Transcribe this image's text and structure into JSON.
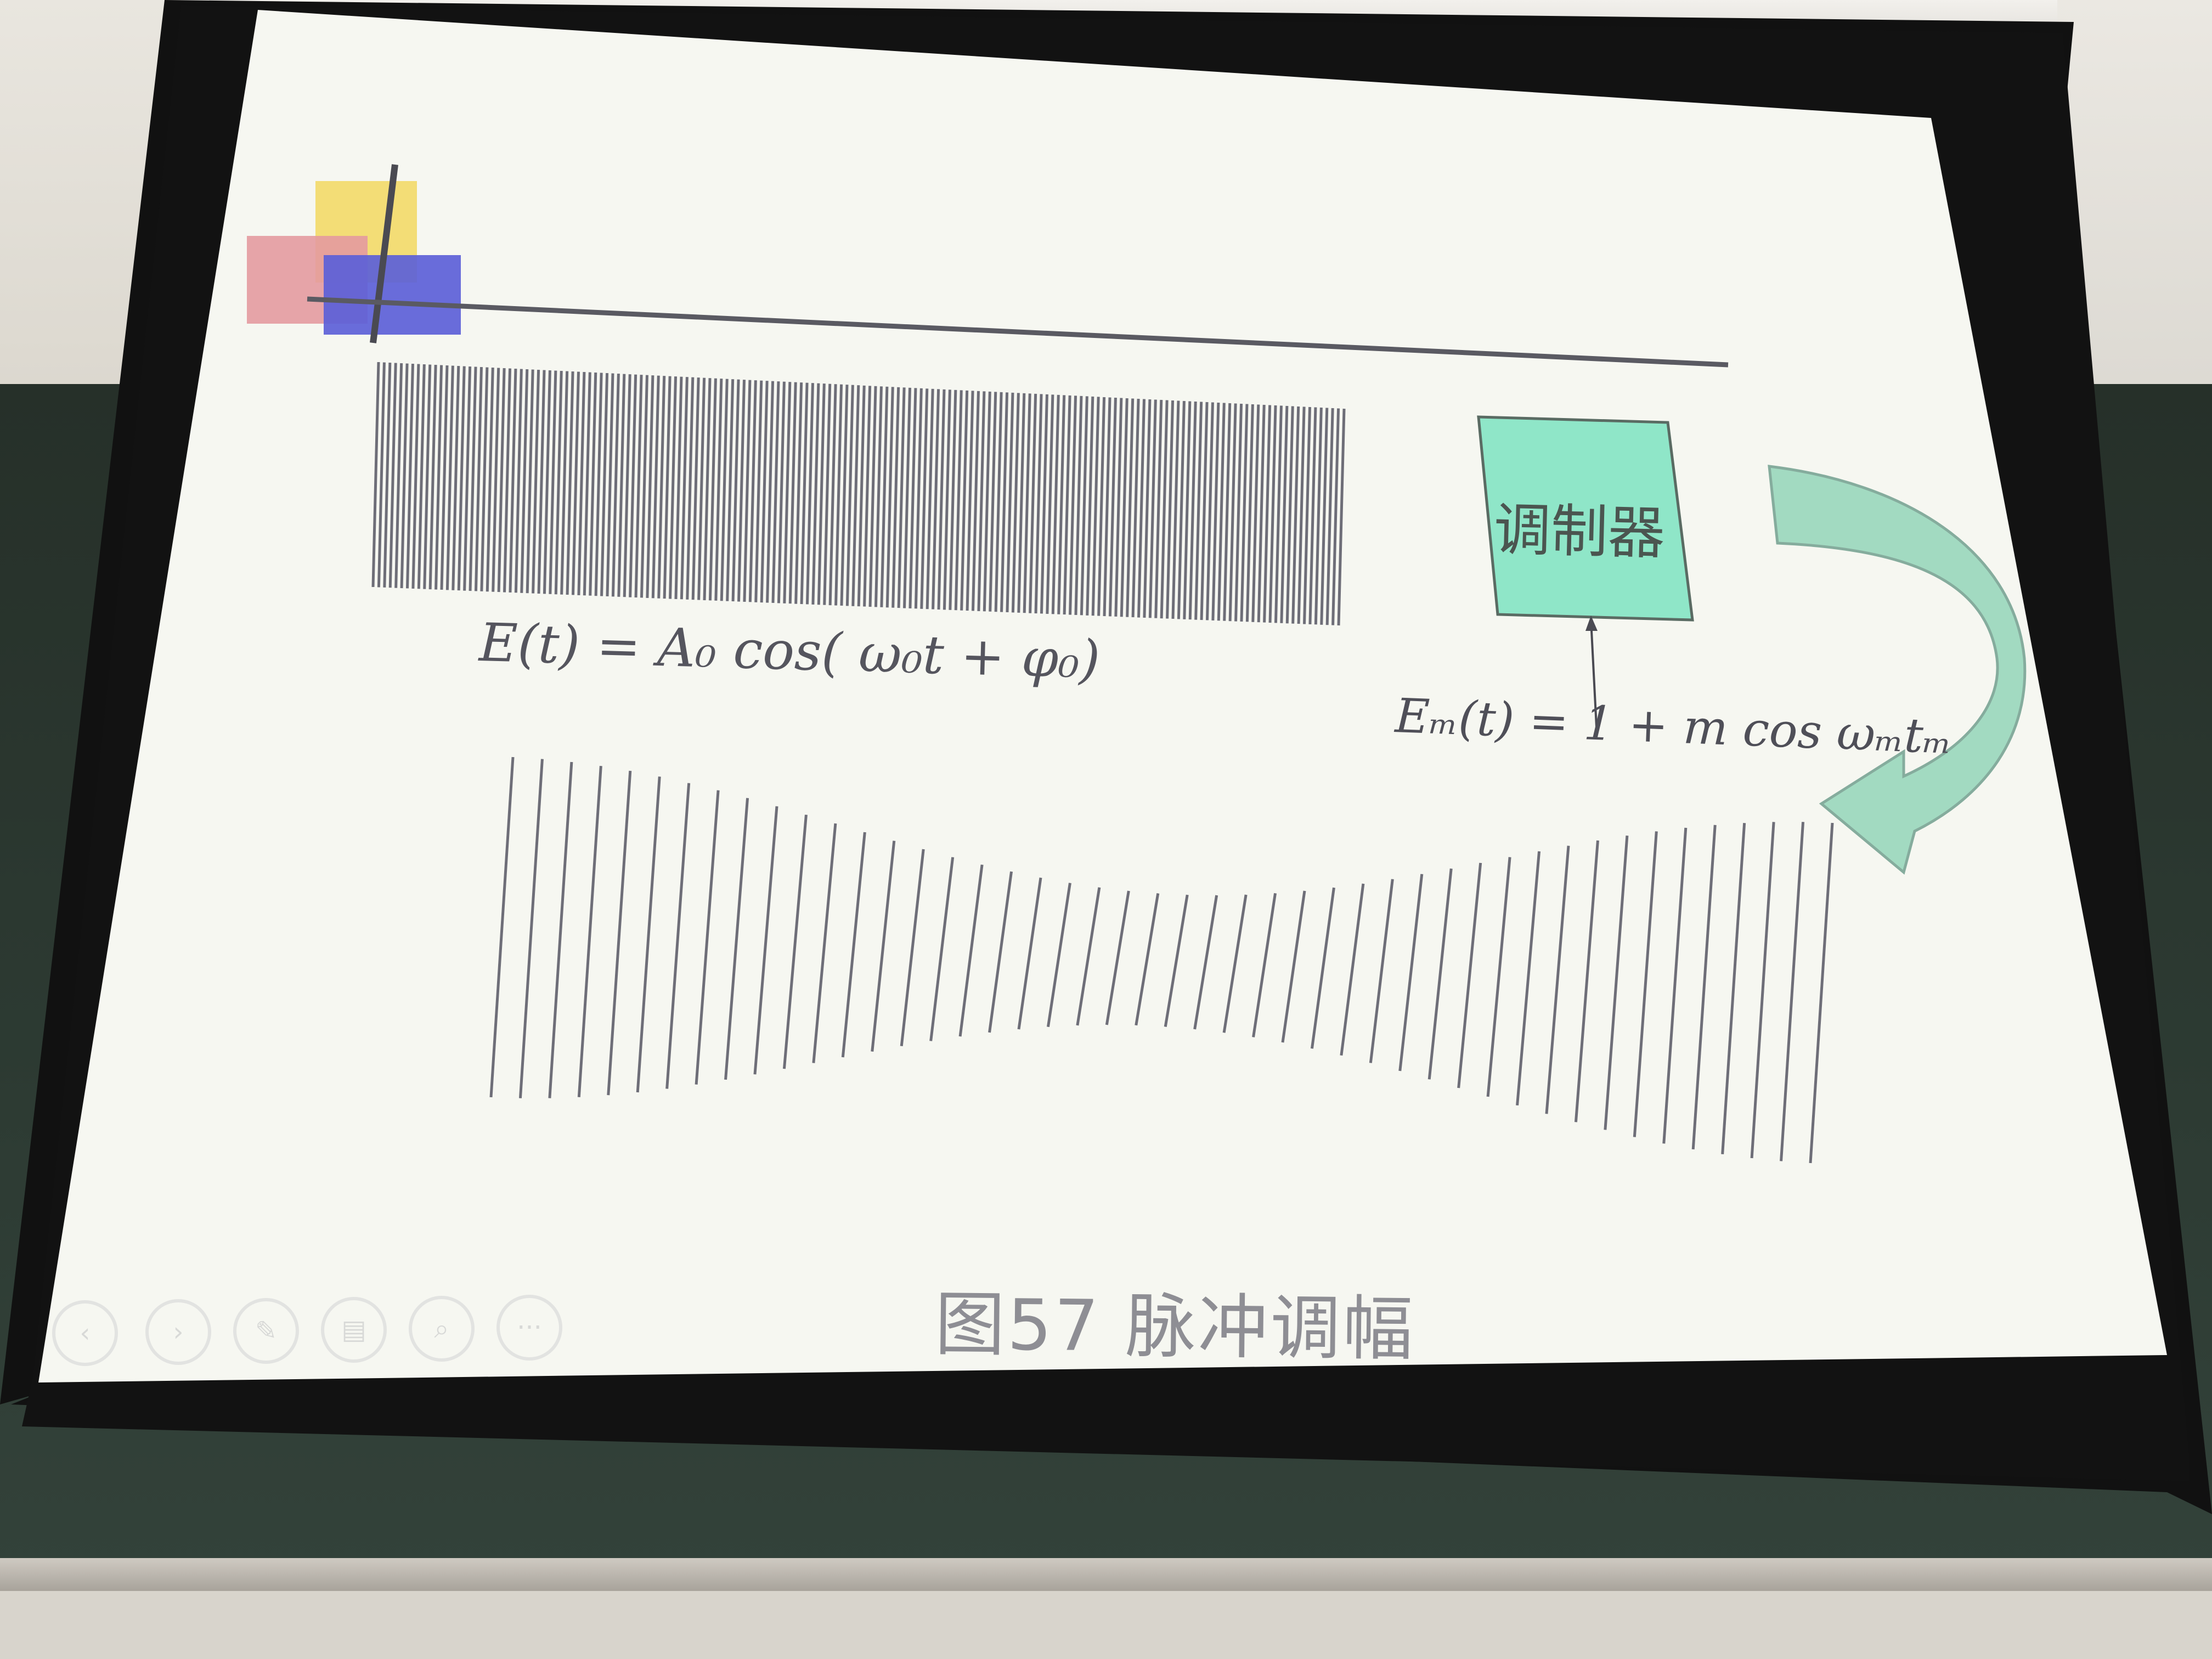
{
  "slide": {
    "carrier_equation": "E(t) = A₀ cos( ω₀t + φ₀)",
    "modulating_equation": "Eₘ(t) = 1 + m cos ωₘtₘ",
    "modulator_label": "调制器",
    "caption": "图57   脉冲调幅",
    "box_color": "#8fe6c8",
    "arrow_color": "#9ed9bf",
    "wave_color": "#6e6e78"
  },
  "nav": {
    "prev": "‹",
    "next": "›",
    "pen": "✎",
    "menu": "▤",
    "zoom": "⌕",
    "more": "···"
  }
}
